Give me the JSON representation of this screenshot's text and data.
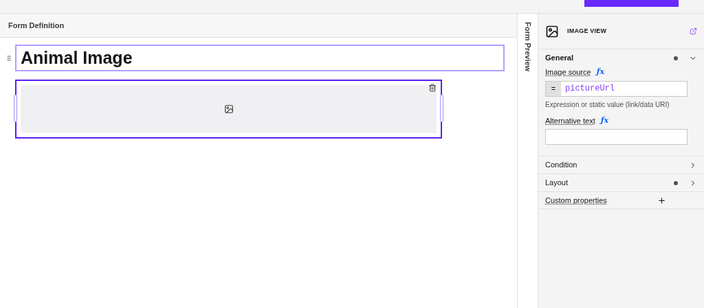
{
  "canvas": {
    "header": "Form Definition",
    "heading": "Animal Image",
    "image_component": {
      "selected": true
    }
  },
  "side_tab": {
    "label": "Form Preview"
  },
  "properties": {
    "title": "IMAGE VIEW",
    "sections": [
      {
        "kind": "accordion",
        "label": "General",
        "expanded": true,
        "modified": true,
        "fields": [
          {
            "label": "Image source",
            "formula": "ƒx",
            "prefix": "=",
            "value": "pictureUrl",
            "hint": "Expression or static value (link/data URI)"
          },
          {
            "label": "Alternative text",
            "formula": "ƒx"
          }
        ]
      },
      {
        "kind": "accordion",
        "label": "Condition",
        "expanded": false,
        "modified": false
      },
      {
        "kind": "accordion",
        "label": "Layout",
        "expanded": false,
        "modified": true
      },
      {
        "kind": "add",
        "label": "Custom properties"
      }
    ]
  }
}
